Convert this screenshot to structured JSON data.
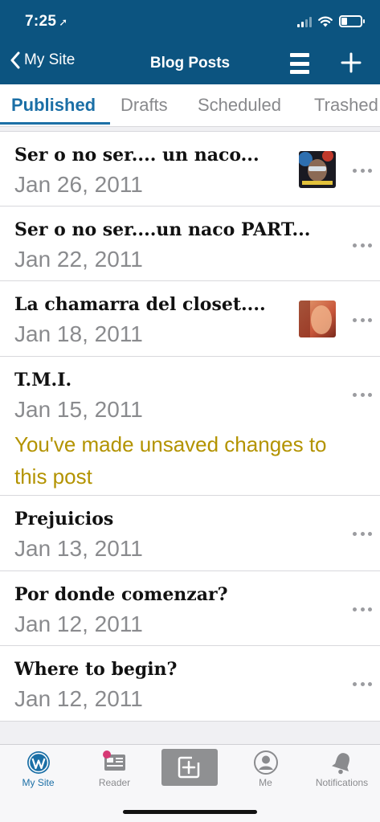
{
  "status_bar": {
    "time": "7:25",
    "location_glyph": "➚"
  },
  "nav": {
    "back_label": "My Site",
    "title": "Blog Posts"
  },
  "tabs": [
    "Published",
    "Drafts",
    "Scheduled",
    "Trashed"
  ],
  "posts": [
    {
      "title": "Ser o no ser.... un naco...",
      "date": "Jan 26, 2011"
    },
    {
      "title": "Ser o no ser....un naco PART...",
      "date": "Jan 22, 2011"
    },
    {
      "title": "La chamarra del closet....",
      "date": "Jan 18, 2011"
    },
    {
      "title": "T.M.I.",
      "date": "Jan 15, 2011",
      "warning_line1": "You've made unsaved changes to",
      "warning_line2": "this post"
    },
    {
      "title": "Prejuicios",
      "date": "Jan 13, 2011"
    },
    {
      "title": "Por donde comenzar?",
      "date": "Jan 12, 2011"
    },
    {
      "title": "Where to begin?",
      "date": "Jan 12, 2011"
    }
  ],
  "tabbar": {
    "my_site": "My Site",
    "reader": "Reader",
    "me": "Me",
    "notifications": "Notifications"
  },
  "colors": {
    "header": "#0c5480",
    "accent": "#1b6fa6",
    "warning": "#b39300"
  }
}
